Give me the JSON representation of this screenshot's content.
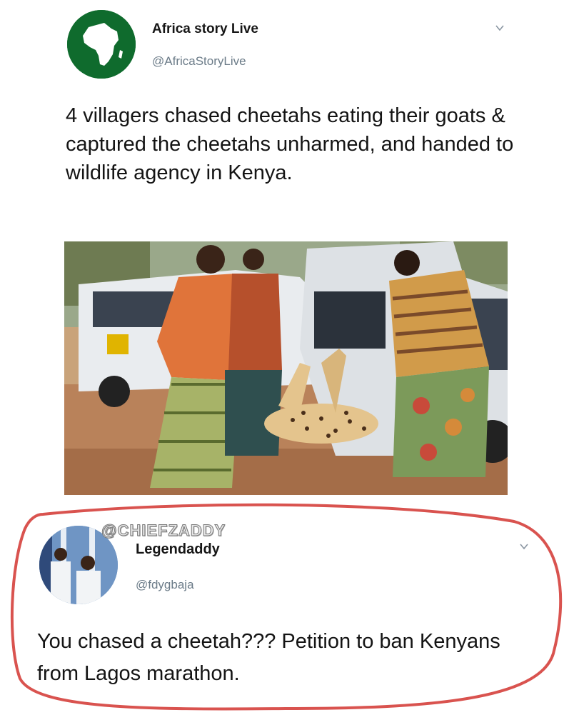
{
  "colors": {
    "handle": "#6b7b88",
    "avatar_green": "#0f6b2d",
    "circle_red": "#d9534f"
  },
  "tweet": {
    "author_name": "Africa story Live",
    "author_handle": "@AfricaStoryLive",
    "avatar_icon": "africa-map-logo",
    "more_icon": "chevron-down-icon",
    "text": "4 villagers chased cheetahs eating their goats & captured the cheetahs unharmed, and handed to wildlife agency in Kenya.",
    "photo_description_icon": "photo-villagers-carrying-cheetah"
  },
  "reply": {
    "watermark": "@CHIEFZADDY",
    "author_name": "Legendaddy",
    "author_handle": "@fdygbaja",
    "avatar_icon": "profile-photo-two-men",
    "more_icon": "chevron-down-icon",
    "text": "You chased a cheetah??? Petition to ban Kenyans from Lagos marathon."
  }
}
